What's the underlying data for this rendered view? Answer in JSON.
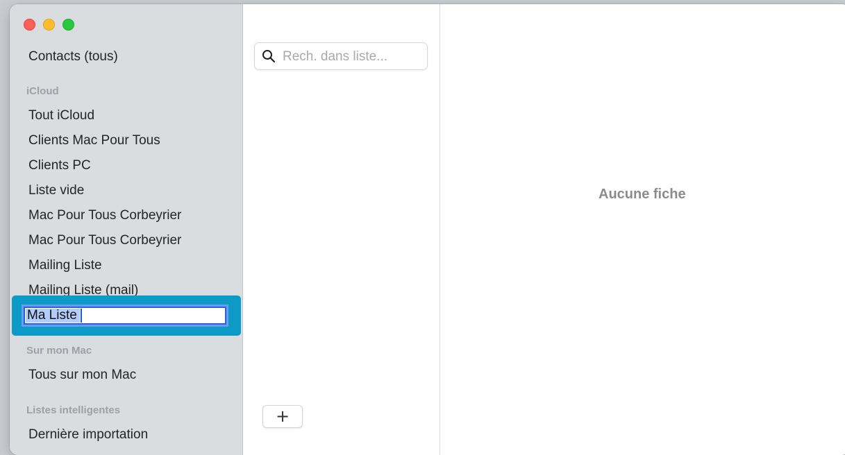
{
  "sidebar": {
    "all_contacts": "Contacts (tous)",
    "sections": {
      "icloud": "iCloud",
      "on_mac": "Sur mon Mac",
      "smart": "Listes intelligentes"
    },
    "icloud_items": [
      "Tout iCloud",
      "Clients Mac Pour Tous",
      "Clients PC",
      "Liste vide",
      "Mac Pour Tous Corbeyrier",
      "Mac Pour Tous Corbeyrier",
      "Mailing Liste",
      "Mailing Liste (mail)"
    ],
    "editing_item": {
      "value": "Ma Liste"
    },
    "mac_items": [
      "Tous sur mon Mac"
    ],
    "smart_items": [
      "Dernière importation"
    ]
  },
  "list": {
    "search_placeholder": "Rech. dans liste...",
    "add_label": "+"
  },
  "detail": {
    "empty_label": "Aucune fiche"
  },
  "colors": {
    "highlight": "#0c9bc6",
    "sidebar_bg": "#dadddf",
    "focus_ring": "#2764dc"
  }
}
